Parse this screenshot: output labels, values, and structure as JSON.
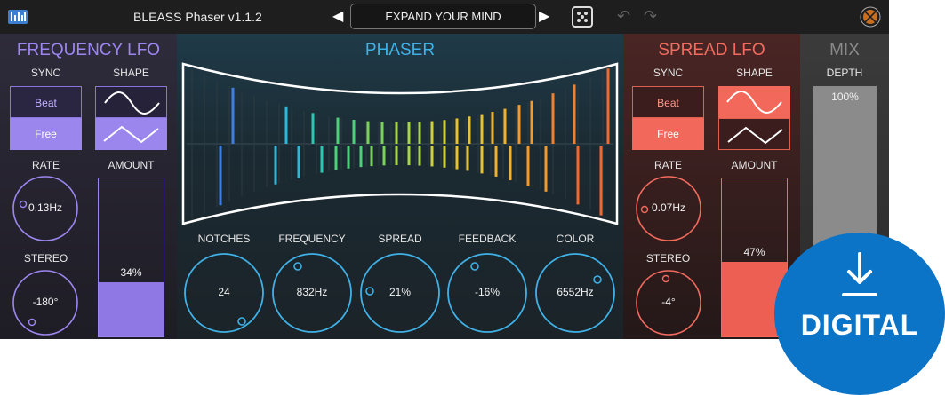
{
  "app": {
    "title": "BLEASS Phaser  v1.1.2"
  },
  "topbar": {
    "preset_name": "EXPAND YOUR MIND",
    "prev_arrow": "◀",
    "next_arrow": "▶",
    "undo": "↶",
    "redo": "↷"
  },
  "frequency_lfo": {
    "title": "FREQUENCY LFO",
    "sync_label": "SYNC",
    "shape_label": "SHAPE",
    "sync_options": [
      "Beat",
      "Free"
    ],
    "sync_selected": "Free",
    "shape_options": [
      "sine-wave-icon",
      "triangle-wave-icon"
    ],
    "shape_selected": "triangle-wave-icon",
    "rate_label": "RATE",
    "rate_value": "0.13Hz",
    "amount_label": "AMOUNT",
    "amount_value": "34%",
    "amount_fraction": 0.34,
    "stereo_label": "STEREO",
    "stereo_value": "-180°",
    "color": "#9d86f0"
  },
  "phaser": {
    "title": "PHASER",
    "knobs": [
      {
        "label": "NOTCHES",
        "value": "24"
      },
      {
        "label": "FREQUENCY",
        "value": "832Hz"
      },
      {
        "label": "SPREAD",
        "value": "21%"
      },
      {
        "label": "FEEDBACK",
        "value": "-16%"
      },
      {
        "label": "COLOR",
        "value": "6552Hz"
      }
    ],
    "color": "#3fb1e6"
  },
  "spread_lfo": {
    "title": "SPREAD LFO",
    "sync_label": "SYNC",
    "shape_label": "SHAPE",
    "sync_options": [
      "Beat",
      "Free"
    ],
    "sync_selected": "Free",
    "shape_options": [
      "sine-wave-icon",
      "triangle-wave-icon"
    ],
    "shape_selected": "sine-wave-icon",
    "rate_label": "RATE",
    "rate_value": "0.07Hz",
    "amount_label": "AMOUNT",
    "amount_value": "47%",
    "amount_fraction": 0.47,
    "stereo_label": "STEREO",
    "stereo_value": "-4°",
    "color": "#f26b5e"
  },
  "mix": {
    "title": "MIX",
    "depth_label": "DEPTH",
    "depth_value": "100%",
    "depth_fraction": 1.0
  },
  "badge": {
    "text": "DIGITAL",
    "icon": "download-icon"
  }
}
